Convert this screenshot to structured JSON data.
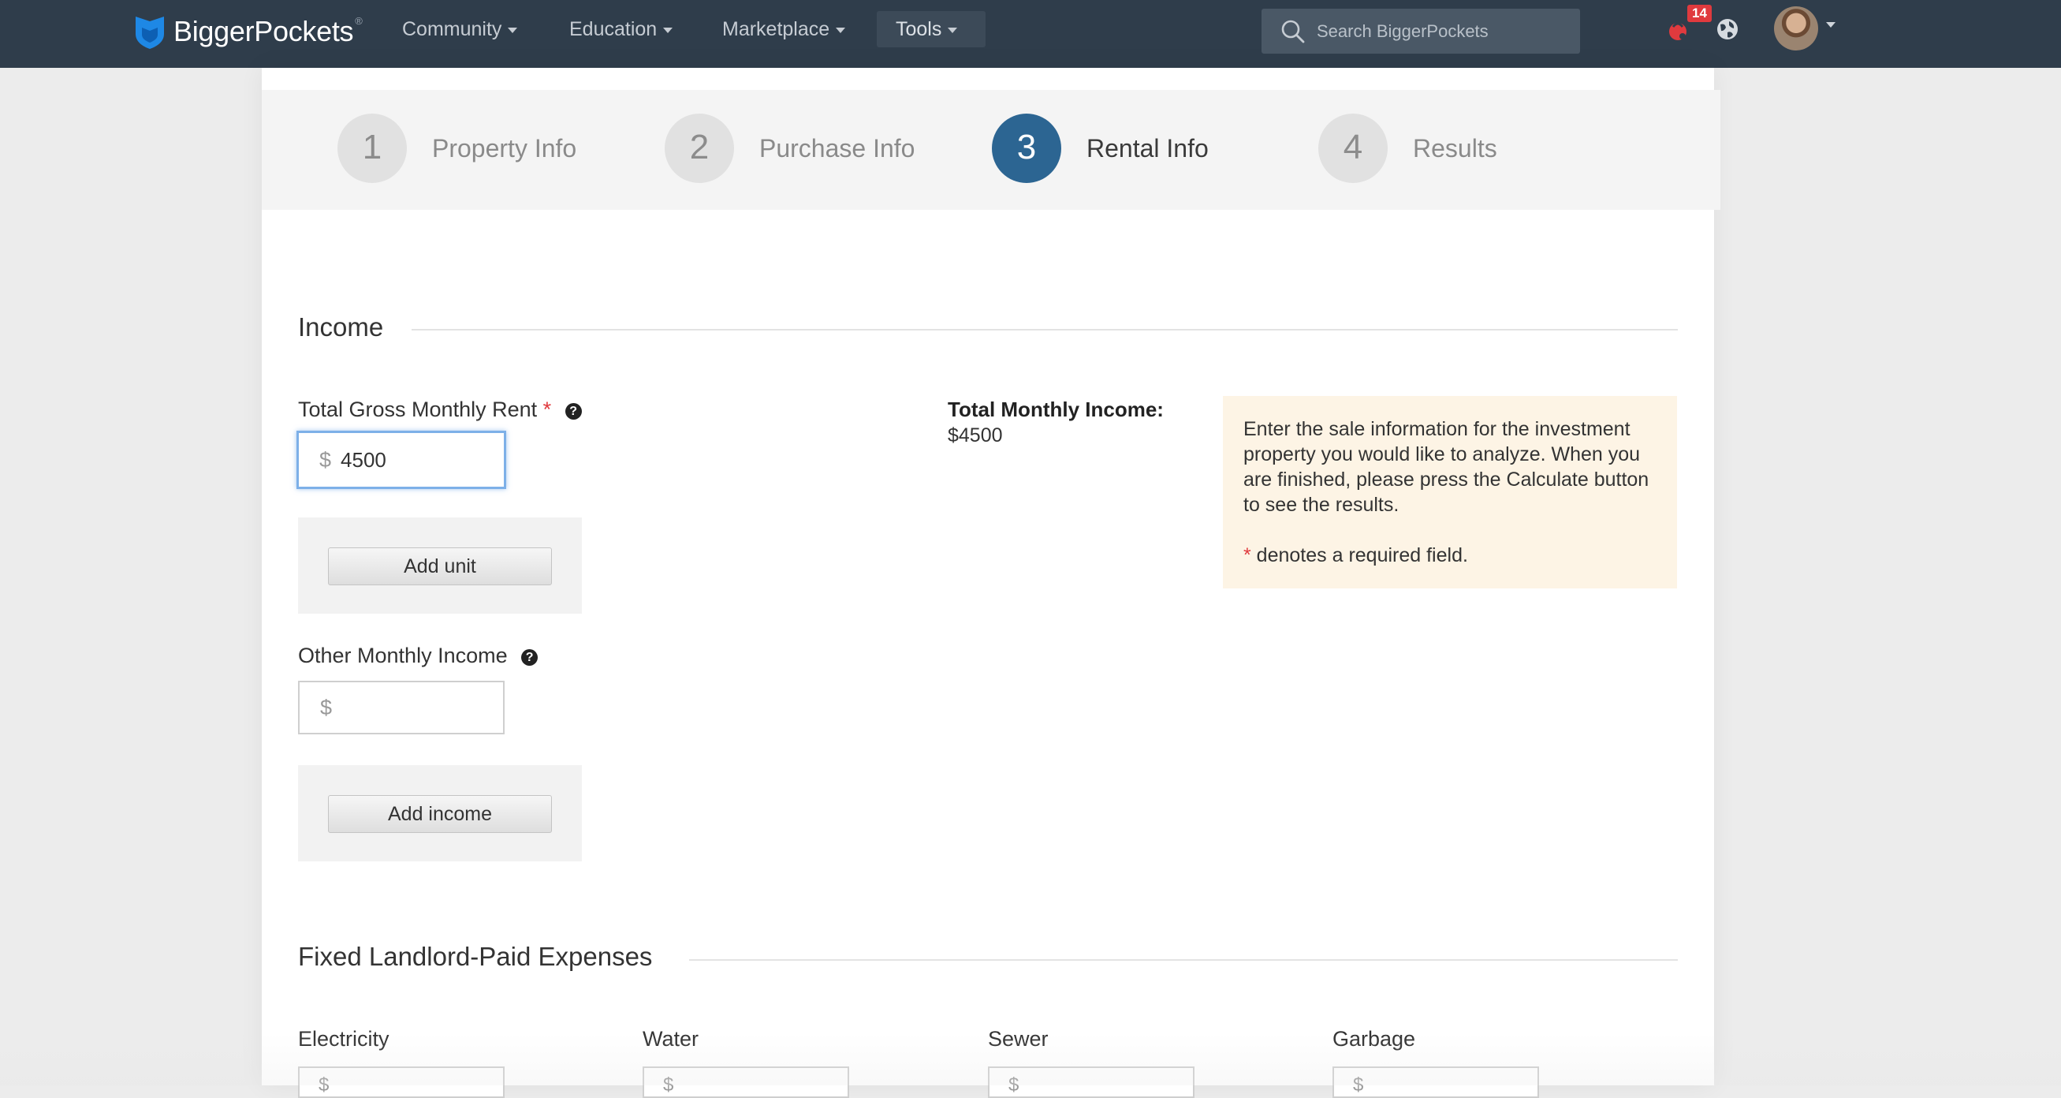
{
  "nav": {
    "brand": "BiggerPockets",
    "brand_reg": "®",
    "items": [
      {
        "label": "Community"
      },
      {
        "label": "Education"
      },
      {
        "label": "Marketplace"
      },
      {
        "label": "Tools"
      }
    ],
    "search_placeholder": "Search BiggerPockets",
    "notification_count": "14",
    "colors": {
      "bar": "#2f3d4b",
      "brand_blue": "#1e88e5",
      "badge": "#e03a3e"
    }
  },
  "steps": [
    {
      "num": "1",
      "label": "Property Info",
      "active": false
    },
    {
      "num": "2",
      "label": "Purchase Info",
      "active": false
    },
    {
      "num": "3",
      "label": "Rental Info",
      "active": true
    },
    {
      "num": "4",
      "label": "Results",
      "active": false
    }
  ],
  "income": {
    "title": "Income",
    "rent_label": "Total Gross Monthly Rent",
    "required_mark": "*",
    "currency": "$",
    "rent_value": "4500",
    "add_unit": "Add unit",
    "other_label": "Other Monthly Income",
    "other_value": "",
    "add_income": "Add income",
    "total_label": "Total Monthly Income:",
    "total_value": "$4500"
  },
  "info": {
    "text": "Enter the sale information for the investment property you would like to analyze. When you are finished, please press the Calculate button to see the results.",
    "required_mark": "*",
    "required_note": " denotes a required field."
  },
  "expenses": {
    "title": "Fixed Landlord-Paid Expenses",
    "fields": [
      {
        "label": "Electricity"
      },
      {
        "label": "Water"
      },
      {
        "label": "Sewer"
      },
      {
        "label": "Garbage"
      }
    ]
  }
}
